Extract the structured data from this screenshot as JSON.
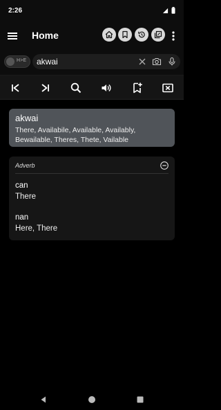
{
  "status": {
    "time": "2:26"
  },
  "appbar": {
    "title": "Home"
  },
  "search": {
    "toggle_label": "H>E",
    "value": "akwai"
  },
  "result": {
    "word": "akwai",
    "suggestions": "There, Availabile, Available, Availably, Bewailable, Theres, Thete, Vailable"
  },
  "definition": {
    "part_of_speech": "Adverb",
    "entries": [
      {
        "word": "can",
        "meaning": "There"
      },
      {
        "word": "nan",
        "meaning": "Here, There"
      }
    ]
  },
  "colors": {
    "accent": "#d9d9d9",
    "result_card": "#505459",
    "background": "#000000"
  }
}
